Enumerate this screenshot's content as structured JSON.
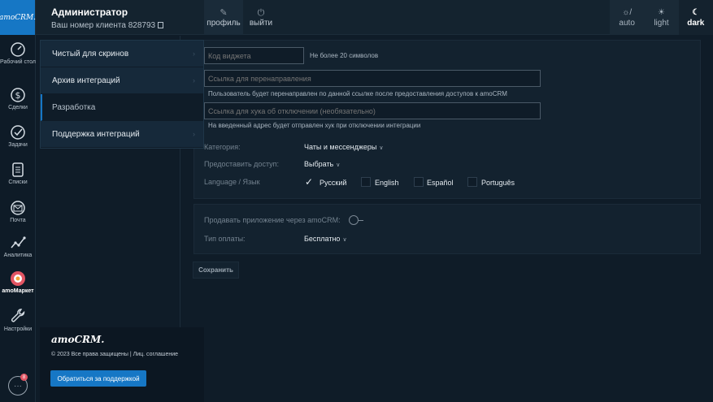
{
  "app": {
    "logo_text": "amoCRM.",
    "brand_color": "#1677c5"
  },
  "rail": {
    "items": [
      {
        "label": "Рабочий стол",
        "icon": "dashboard-gauge-icon"
      },
      {
        "label": "Сделки",
        "icon": "dollar-icon"
      },
      {
        "label": "Задачи",
        "icon": "check-circle-icon"
      },
      {
        "label": "Списки",
        "icon": "list-icon"
      },
      {
        "label": "Почта",
        "icon": "mail-icon"
      },
      {
        "label": "Аналитика",
        "icon": "analytics-icon"
      },
      {
        "label": "amoМаркет",
        "icon": "market-icon"
      },
      {
        "label": "Настройки",
        "icon": "wrench-icon"
      }
    ],
    "chat_badge": "8"
  },
  "header": {
    "user_name": "Администратор",
    "client_number": "Ваш номер клиента 828793",
    "profile_label": "профиль",
    "exit_label": "выйти",
    "themes": [
      {
        "label": "auto",
        "icon": "auto-theme-icon",
        "active": false
      },
      {
        "label": "light",
        "icon": "sun-icon",
        "active": false
      },
      {
        "label": "dark",
        "icon": "moon-icon",
        "active": true
      }
    ]
  },
  "menu": {
    "items": [
      {
        "label": "Чистый для скринов",
        "selected": false
      },
      {
        "label": "Архив интеграций",
        "selected": false
      },
      {
        "label": "Разработка",
        "selected": true
      },
      {
        "label": "Поддержка интеграций",
        "selected": false
      }
    ]
  },
  "form": {
    "widget_code_placeholder": "Код виджета",
    "widget_code_hint": "Не более 20 символов",
    "redirect_placeholder": "Ссылка для перенаправления",
    "redirect_hint": "Пользователь будет перенаправлен по данной ссылке после предоставления доступов к amoCRM",
    "hook_placeholder": "Ссылка для хука об отключении (необязательно)",
    "hook_hint": "На введенный адрес будет отправлен хук при отключении интеграции",
    "category_label": "Категория:",
    "category_value": "Чаты и мессенджеры",
    "access_label": "Предоставить доступ:",
    "access_value": "Выбрать",
    "language_label": "Language / Язык",
    "languages": [
      {
        "label": "Русский",
        "checked": true
      },
      {
        "label": "English",
        "checked": false
      },
      {
        "label": "Español",
        "checked": false
      },
      {
        "label": "Português",
        "checked": false
      }
    ],
    "sell_label": "Продавать приложение через amoCRM:",
    "payment_label": "Тип оплаты:",
    "payment_value": "Бесплатно",
    "save_label": "Сохранить"
  },
  "footer": {
    "logo_text": "amoCRM.",
    "copyright": "© 2023 Все права защищены | Лиц. соглашение",
    "support_label": "Обратиться за поддержкой"
  }
}
